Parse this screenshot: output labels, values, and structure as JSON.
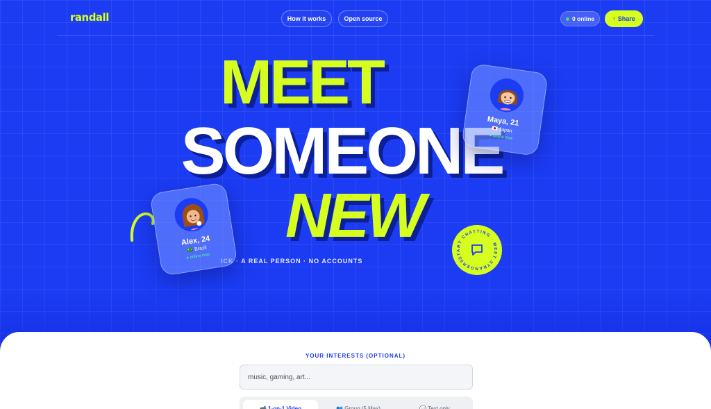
{
  "header": {
    "logo": "randall",
    "nav": [
      {
        "label": "How it works"
      },
      {
        "label": "Open source"
      }
    ],
    "online_label": "0 online",
    "share_label": "Share",
    "share_icon": "arrow-up-icon"
  },
  "hero": {
    "line1": "MEET",
    "line2": "SOMEONE",
    "line3": "NEW",
    "tagline": "ICK · A REAL PERSON · NO ACCOUNTS",
    "badge_text": "START CHATTING · MEET STRANGERS ·",
    "badge_icon": "chat-bubble-icon"
  },
  "cards": [
    {
      "name": "Maya, 21",
      "flag": "🇯🇵",
      "country": "Japan",
      "status": "● online now"
    },
    {
      "name": "Alex, 24",
      "flag": "🇧🇷",
      "country": "Brazil",
      "status": "● online now"
    }
  ],
  "interests": {
    "label": "YOUR INTERESTS (OPTIONAL)",
    "placeholder": "music, gaming, art..."
  },
  "modes": [
    {
      "label": "📹 1-on-1 Video"
    },
    {
      "label": "👥 Group (5 Max)"
    },
    {
      "label": "💬 Text only"
    }
  ],
  "colors": {
    "brand_blue": "#1b3cf3",
    "accent_lime": "#d6ff1f",
    "online_green": "#3ce37a"
  }
}
